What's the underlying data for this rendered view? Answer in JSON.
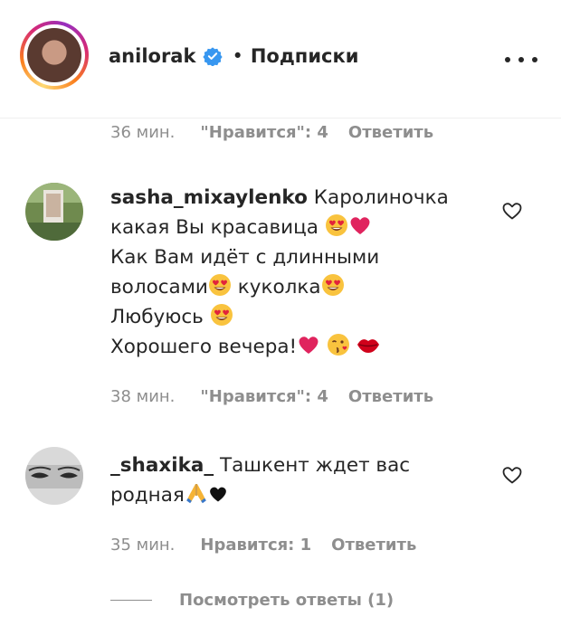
{
  "post_header": {
    "username": "anilorak",
    "separator": "•",
    "follow_label": "Подписки",
    "verified_icon": "verified-badge-icon",
    "more_icon": "more-options-icon"
  },
  "comments": [
    {
      "time": "36 мин.",
      "likes": "\"Нравится\": 4",
      "reply": "Ответить"
    },
    {
      "username": "sasha_mixaylenko",
      "lines": [
        "Каролиночка",
        "какая Вы красавица",
        "Как Вам идёт с длинными",
        "волосами",
        "куколка",
        "Любуюсь",
        "Хорошего вечера!"
      ],
      "time": "38 мин.",
      "likes": "\"Нравится\": 4",
      "reply": "Ответить"
    },
    {
      "username": "_shaxika_",
      "lines": [
        "Ташкент ждет вас",
        "родная"
      ],
      "time": "35 мин.",
      "likes": "Нравится: 1",
      "reply": "Ответить",
      "view_replies": "Посмотреть ответы (1)"
    }
  ],
  "colors": {
    "text": "#262626",
    "secondary": "#8e8e8e",
    "verified": "#3897f0",
    "heart_red": "#e0245e"
  }
}
